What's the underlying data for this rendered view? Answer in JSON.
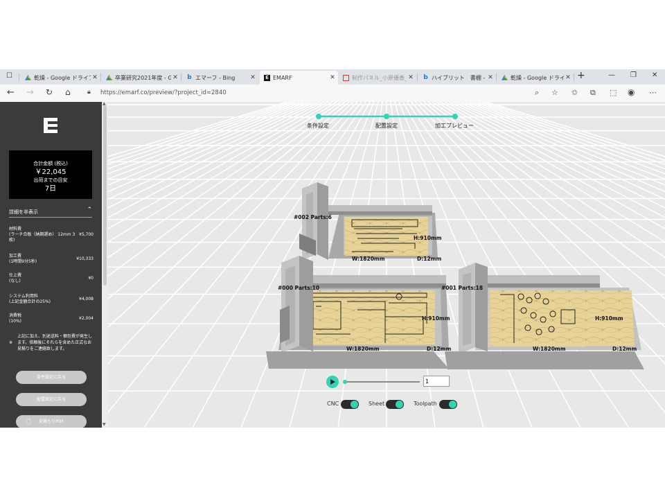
{
  "browser": {
    "tabs": [
      {
        "label": "乾燥 - Google ドライブ",
        "icon": "google-drive-icon"
      },
      {
        "label": "卒業研究2021年度 - G",
        "icon": "google-drive-icon"
      },
      {
        "label": "エマーフ - Bing",
        "icon": "bing-icon"
      },
      {
        "label": "EMARF",
        "icon": "emarf-icon",
        "active": true
      },
      {
        "label": "制作パネル_小原優香_",
        "icon": "pdf-icon"
      },
      {
        "label": "ハイブリット　書棚 - Bin",
        "icon": "bing-icon"
      },
      {
        "label": "乾燥 - Google ドライブ",
        "icon": "google-drive-icon"
      }
    ],
    "new_tab": "+",
    "url": "https://emarf.co/preview/?project_id=2840"
  },
  "sidebar": {
    "logo": "E",
    "total_label": "合計金額 (税込)",
    "total_value": "￥22,045",
    "ship_label": "出荷までの目安",
    "ship_value": "7日",
    "details_toggle": "詳細を非表示",
    "costs": [
      {
        "label": "材料費\n(ラーチ合板（納期遅め）12mm 3枚)",
        "value": "¥5,700"
      },
      {
        "label": "加工費\n(1時間9分5秒)",
        "value": "¥10,333"
      },
      {
        "label": "仕上費\n(なし)",
        "value": "¥0"
      },
      {
        "label": "システム利用料\n(上記金額合計の25%)",
        "value": "¥4,008"
      },
      {
        "label": "消費税\n(10%)",
        "value": "¥2,004"
      }
    ],
    "note_mark": "※",
    "note": "上記に加え、別途送料・梱包費が発生します。依頼後にそれらを含めた正式なお見積りをご連絡致します。",
    "buttons": {
      "back_conditions": "条件設定に戻る",
      "back_layout": "配置設定に戻る",
      "quote_pdf": "見積もりPDF"
    }
  },
  "steps": [
    "条件設定",
    "配置設定",
    "加工プレビュー"
  ],
  "sheets": [
    {
      "id": "#002 Parts:6",
      "height": "H:910mm",
      "width": "W:1820mm",
      "depth": "D:12mm"
    },
    {
      "id": "#000 Parts:10",
      "height": "H:910mm",
      "width": "W:1820mm",
      "depth": "D:12mm"
    },
    {
      "id": "#001 Parts:18",
      "height": "H:910mm",
      "width": "W:1820mm",
      "depth": "D:12mm"
    }
  ],
  "playback": {
    "frame_value": "1",
    "progress": 0
  },
  "toggles": [
    {
      "label": "CNC",
      "on": true
    },
    {
      "label": "Sheet",
      "on": true
    },
    {
      "label": "Toolpath",
      "on": true
    }
  ],
  "colors": {
    "accent": "#33d4b1",
    "sidebar_bg": "#3a3b3d",
    "wood": "#e6d196"
  }
}
